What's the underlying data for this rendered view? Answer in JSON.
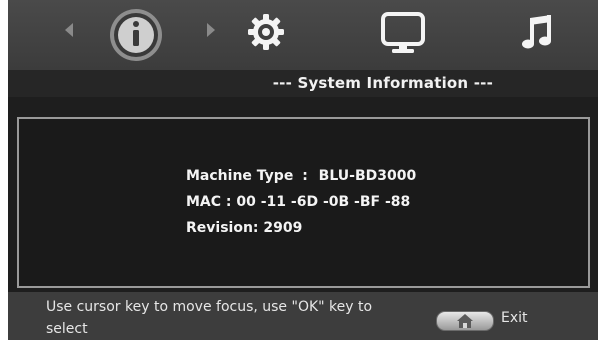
{
  "menu": {
    "items": [
      {
        "icon": "info-icon",
        "selected": true
      },
      {
        "icon": "gear-icon",
        "selected": false
      },
      {
        "icon": "monitor-icon",
        "selected": false
      },
      {
        "icon": "music-note-icon",
        "selected": false
      }
    ]
  },
  "page": {
    "title": "--- System Information ---"
  },
  "system_info": {
    "machine_type_label": "Machine Type",
    "machine_type_sep": ":",
    "machine_type_value": "BLU-BD3000",
    "mac_label": "MAC :",
    "mac_value": "00 -11 -6D -0B -BF -88",
    "revision_label": "Revision:",
    "revision_value": "2909"
  },
  "footer": {
    "hint": "Use cursor key to move focus, use \"OK\" key to select",
    "exit_label": "Exit"
  },
  "colors": {
    "background": "#1e1e1e",
    "topbar": "#444444",
    "text": "#f2f2f2",
    "panel_border": "#9a9a9a"
  }
}
